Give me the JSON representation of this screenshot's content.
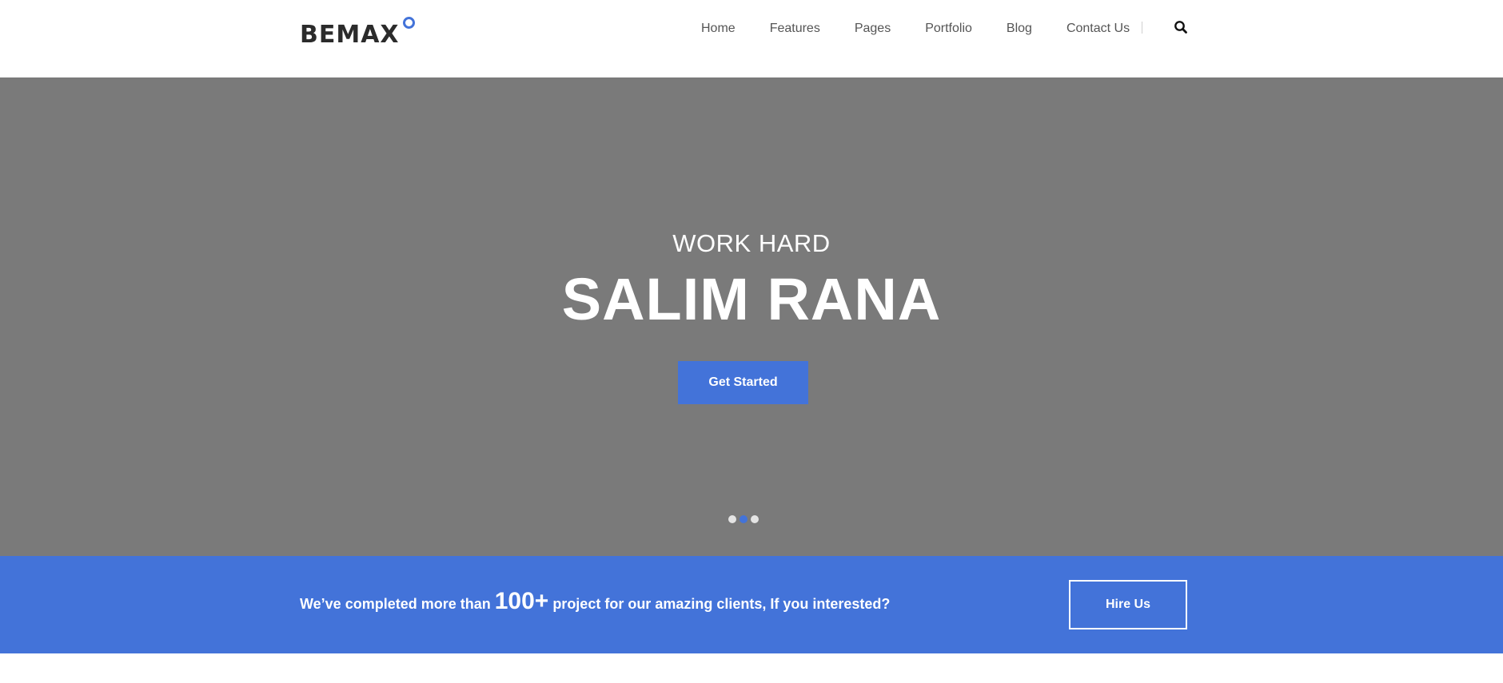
{
  "colors": {
    "accent": "#4373d9",
    "hero_bg": "#7a7a7a",
    "header_bg": "#ffffff"
  },
  "brand": {
    "name": "BEMAX"
  },
  "nav": {
    "items": [
      {
        "label": "Home"
      },
      {
        "label": "Features"
      },
      {
        "label": "Pages"
      },
      {
        "label": "Portfolio"
      },
      {
        "label": "Blog"
      },
      {
        "label": "Contact Us"
      }
    ],
    "search_icon": "search-icon"
  },
  "hero": {
    "subtitle": "WORK HARD",
    "title": "SALIM RANA",
    "button_label": "Get Started",
    "slider": {
      "count": 3,
      "active_index": 1
    }
  },
  "cta": {
    "text_before": "We’ve completed more than",
    "number": "100+",
    "text_after": "project for our amazing clients, If you interested?",
    "button_label": "Hire Us"
  }
}
